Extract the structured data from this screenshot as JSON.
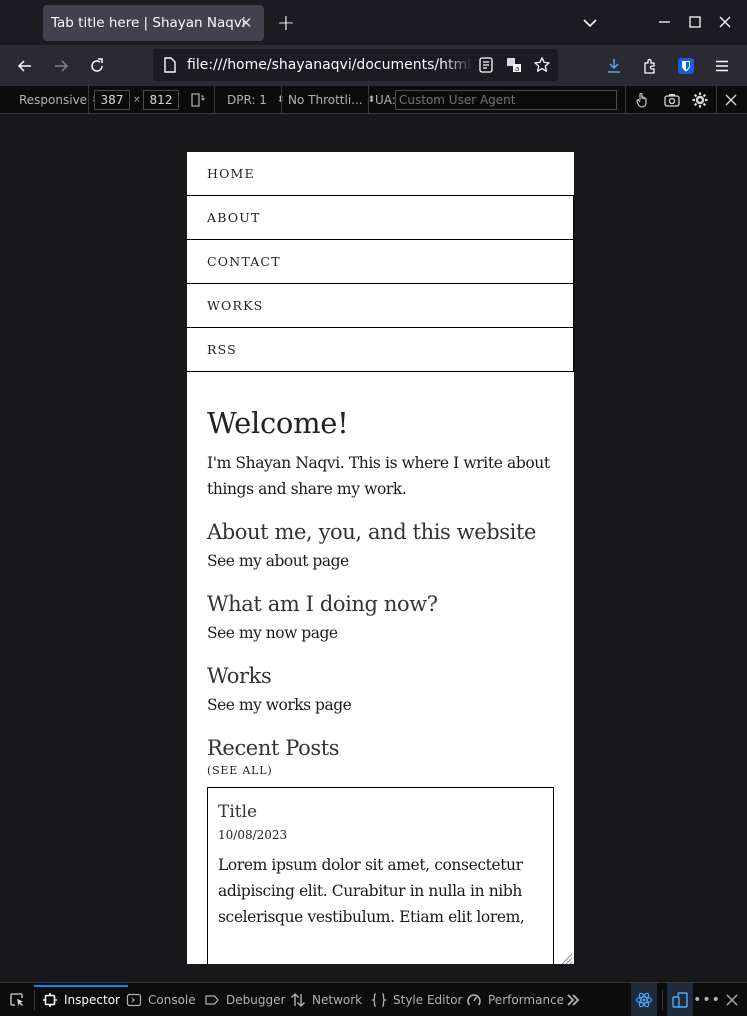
{
  "browser": {
    "tab": {
      "title": "Tab title here | Shayan Naqvi",
      "close_icon": "close-icon"
    },
    "new_tab_icon": "plus-icon",
    "tab_list_icon": "chevron-down-icon",
    "window_controls": [
      "minimize-icon",
      "maximize-icon",
      "close-icon"
    ],
    "nav": {
      "back_icon": "arrow-left-icon",
      "forward_icon": "arrow-right-icon",
      "reload_icon": "reload-icon",
      "url": "file:///home/shayanaqvi/documents/html/website/index.html",
      "url_visible": "file:///home/shayanaqvi/documents/html/we",
      "page_icon": "document-icon",
      "reader_icon": "reader-view-icon",
      "translate_icon": "translate-icon",
      "bookmark_icon": "star-icon",
      "downloads_icon": "download-icon",
      "extensions_icon": "puzzle-icon",
      "bitwarden_icon": "shield-icon",
      "menu_icon": "hamburger-menu-icon"
    }
  },
  "rdm_toolbar": {
    "device": "Responsive",
    "width": "387",
    "times": "×",
    "height": "812",
    "rotate_icon": "rotate-device-icon",
    "dpr": "DPR: 1",
    "throttling": "No Throttli...",
    "ua_label": "UA:",
    "ua_placeholder": "Custom User Agent",
    "touch_icon": "touch-simulation-icon",
    "screenshot_icon": "camera-icon",
    "settings_icon": "gear-icon",
    "close_icon": "close-icon"
  },
  "page": {
    "nav": [
      "Home",
      "About",
      "Contact",
      "Works",
      "RSS"
    ],
    "welcome_heading": "Welcome!",
    "intro": "I'm Shayan Naqvi. This is where I write about things and share my work.",
    "sections": [
      {
        "heading": "About me, you, and this website",
        "link": "See my about page"
      },
      {
        "heading": "What am I doing now?",
        "link": "See my now page"
      },
      {
        "heading": "Works",
        "link": "See my works page"
      }
    ],
    "recent_posts": {
      "heading": "Recent Posts",
      "see_all": "(see all)",
      "posts": [
        {
          "title": "Title",
          "date": "10/08/2023",
          "excerpt": "Lorem ipsum dolor sit amet, consectetur adipiscing elit. Curabitur in nulla in nibh scelerisque vestibulum. Etiam elit lorem,"
        }
      ]
    }
  },
  "devtools": {
    "picker_icon": "element-picker-icon",
    "tabs": [
      {
        "label": "Inspector",
        "icon": "inspector-icon",
        "active": true
      },
      {
        "label": "Console",
        "icon": "console-icon",
        "active": false
      },
      {
        "label": "Debugger",
        "icon": "debugger-icon",
        "active": false
      },
      {
        "label": "Network",
        "icon": "network-icon",
        "active": false
      },
      {
        "label": "Style Editor",
        "icon": "style-editor-icon",
        "active": false
      },
      {
        "label": "Performance",
        "icon": "performance-icon",
        "active": false
      }
    ],
    "overflow_icon": "double-chevron-right-icon",
    "react_icon": "react-icon",
    "responsive_icon": "responsive-design-icon",
    "more_icon": "more-horizontal-icon",
    "close_icon": "close-icon",
    "accent": "#0a84ff"
  }
}
